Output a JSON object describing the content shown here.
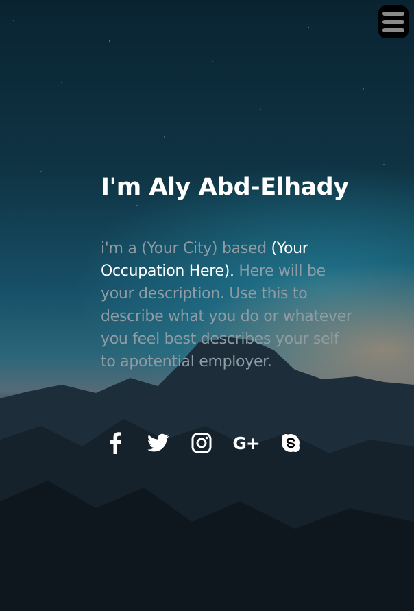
{
  "hero": {
    "title": "I'm Aly Abd-Elhady",
    "description": {
      "intro": "i'm a (Your City) based ",
      "occupation": "(Your Occupation Here).",
      "rest": " Here will be your description. Use this to describe what you do or whatever you feel best describes your self to apotential employer."
    }
  },
  "menu_button": {
    "icon": "hamburger-menu-icon"
  },
  "social_links": [
    {
      "icon": "facebook-icon"
    },
    {
      "icon": "twitter-icon"
    },
    {
      "icon": "instagram-icon"
    },
    {
      "icon": "google-plus-icon",
      "glyph": "G+"
    },
    {
      "icon": "skype-icon"
    }
  ]
}
